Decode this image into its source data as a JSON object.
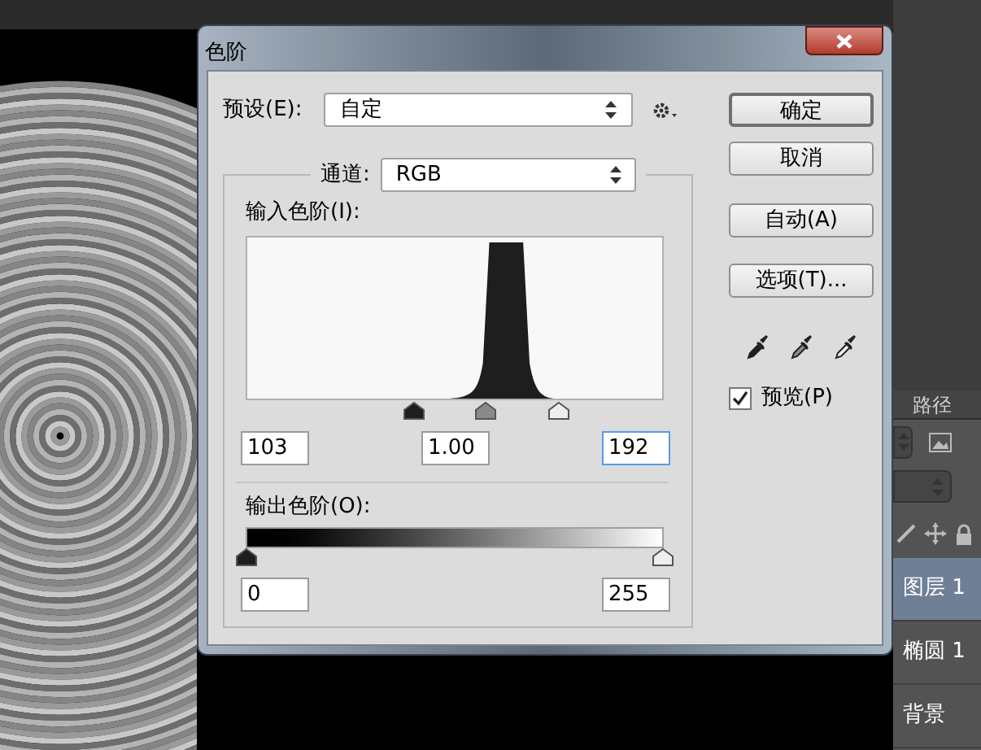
{
  "window": {
    "title": "色阶"
  },
  "preset": {
    "label": "预设(E):",
    "value": "自定"
  },
  "channel": {
    "label": "通道:",
    "value": "RGB"
  },
  "input_levels": {
    "label": "输入色阶(I):",
    "sliders": [
      {
        "kind": "black",
        "level": 0.404
      },
      {
        "kind": "gray",
        "level": 0.578
      },
      {
        "kind": "white",
        "level": 0.753
      }
    ],
    "fields": [
      {
        "value": "103",
        "focused": false
      },
      {
        "value": "1.00",
        "focused": false
      },
      {
        "value": "192",
        "focused": true
      }
    ]
  },
  "output_levels": {
    "label": "输出色阶(O):",
    "sliders": [
      {
        "kind": "black",
        "level": 0
      },
      {
        "kind": "white",
        "level": 1
      }
    ],
    "fields": [
      {
        "value": "0",
        "focused": false
      },
      {
        "value": "255",
        "focused": false
      }
    ]
  },
  "buttons": [
    {
      "label": "确定",
      "default": true
    },
    {
      "label": "取消",
      "default": false
    },
    {
      "label": "自动(A)",
      "default": false
    },
    {
      "label": "选项(T)...",
      "default": false
    }
  ],
  "eyedroppers": [
    {
      "kind": "black"
    },
    {
      "kind": "gray"
    },
    {
      "kind": "white"
    }
  ],
  "preview": {
    "label": "预览(P)",
    "checked": true
  },
  "layers_panel": {
    "tab": "路径",
    "layers": [
      {
        "name": "图层 1",
        "selected": true
      },
      {
        "name": "椭圆 1",
        "selected": false
      },
      {
        "name": "背景",
        "selected": false
      }
    ]
  }
}
